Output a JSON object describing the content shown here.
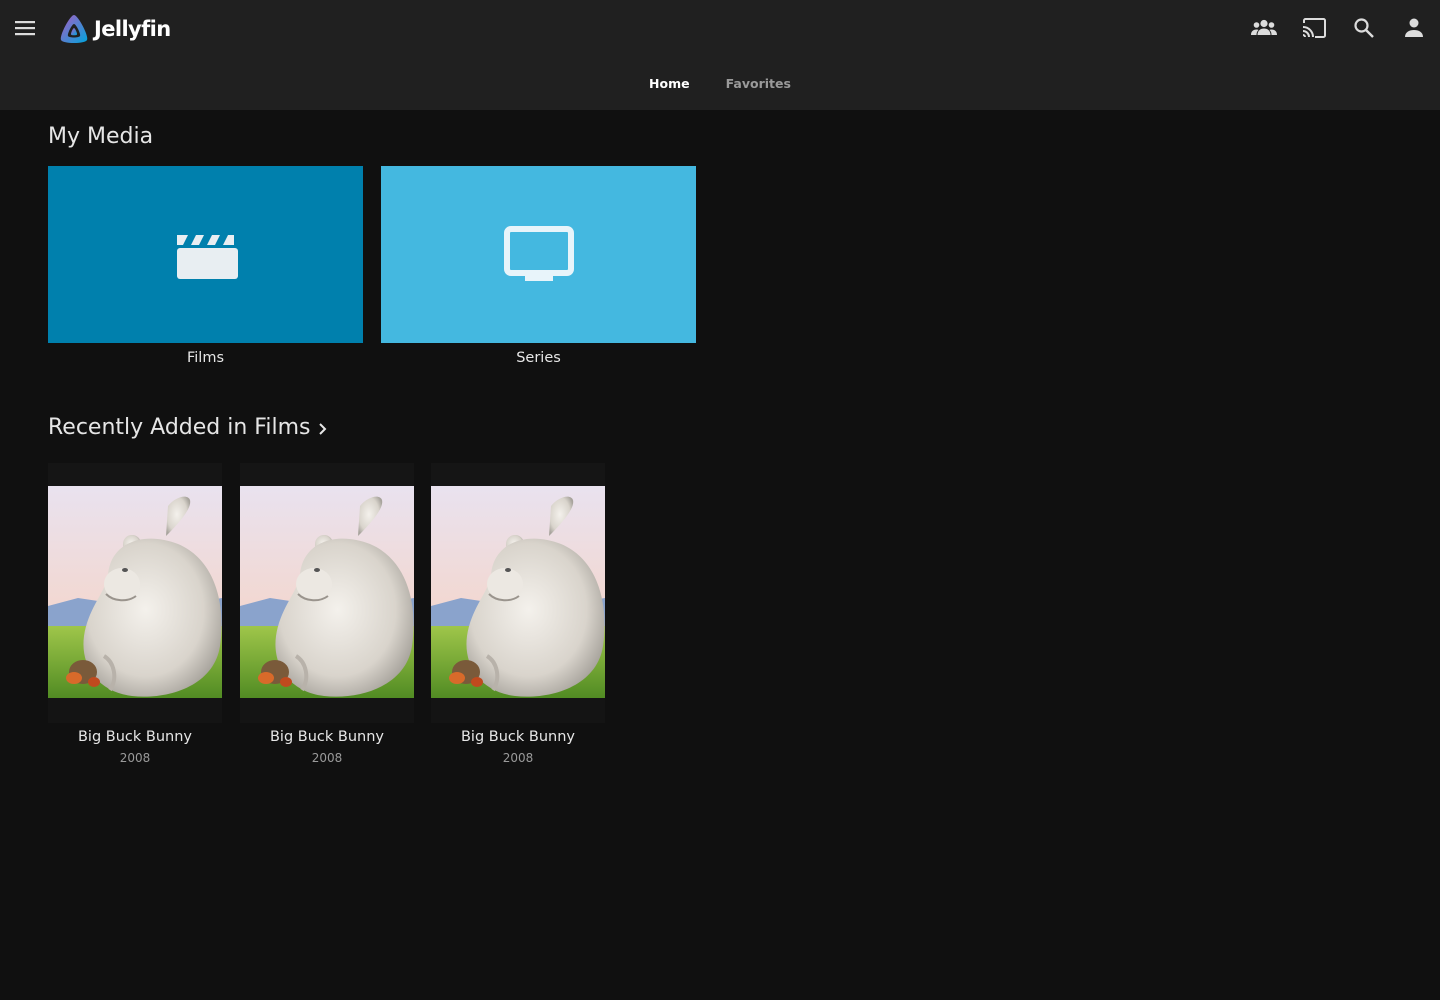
{
  "app": {
    "logo_text": "Jellyfin",
    "accent_gradient": [
      "#aa5cc3",
      "#00a4dc"
    ]
  },
  "header": {
    "icons": [
      "menu-icon",
      "users-icon",
      "cast-icon",
      "search-icon",
      "user-icon"
    ]
  },
  "tabs": [
    {
      "label": "Home",
      "active": true
    },
    {
      "label": "Favorites",
      "active": false
    }
  ],
  "my_media": {
    "title": "My Media",
    "libraries": [
      {
        "label": "Films",
        "icon": "clapperboard-icon",
        "color": "#0080ad"
      },
      {
        "label": "Series",
        "icon": "tv-icon",
        "color": "#44b8e0"
      }
    ]
  },
  "recently_added": {
    "title": "Recently Added in Films",
    "items": [
      {
        "title": "Big Buck Bunny",
        "year": "2008"
      },
      {
        "title": "Big Buck Bunny",
        "year": "2008"
      },
      {
        "title": "Big Buck Bunny",
        "year": "2008"
      }
    ]
  }
}
